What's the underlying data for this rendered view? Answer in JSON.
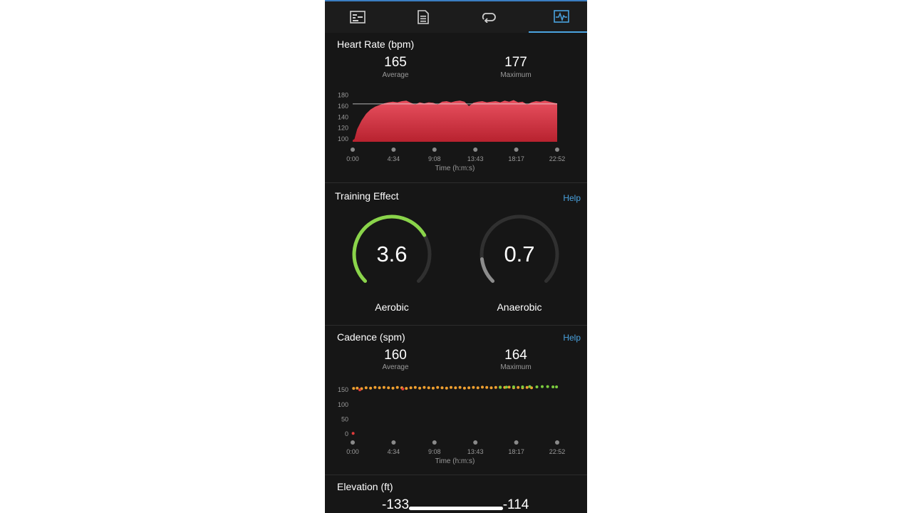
{
  "tabs": [
    {
      "icon": "summary-chart-icon"
    },
    {
      "icon": "document-list-icon"
    },
    {
      "icon": "laps-loop-icon"
    },
    {
      "icon": "activity-graph-icon",
      "active": true
    }
  ],
  "heart_rate": {
    "title": "Heart Rate (bpm)",
    "average_value": "165",
    "average_label": "Average",
    "maximum_value": "177",
    "maximum_label": "Maximum",
    "chart_data": {
      "type": "area",
      "title": "Heart Rate (bpm)",
      "xlabel": "Time (h:m:s)",
      "ylabel": "",
      "x_ticks": [
        "0:00",
        "4:34",
        "9:08",
        "13:43",
        "18:17",
        "22:52"
      ],
      "y_ticks": [
        "180",
        "160",
        "140",
        "120",
        "100"
      ],
      "ylim": [
        95,
        182
      ],
      "reference_line": 164,
      "color": "#d6374a",
      "series": [
        {
          "x_min": [
            0,
            0.2,
            0.5,
            1.0,
            1.5,
            2.0,
            2.5,
            3.0,
            3.5,
            4.0,
            4.5,
            5.0,
            5.5,
            6.0,
            6.5,
            7.0,
            7.5,
            8.0,
            8.5,
            9.0,
            9.5,
            10.0,
            10.5,
            11.0,
            11.5,
            12.0,
            12.5,
            13.0,
            13.5,
            14.0,
            14.5,
            15.0,
            15.5,
            16.0,
            16.5,
            17.0,
            17.5,
            18.0,
            18.5,
            19.0,
            19.5,
            20.0,
            20.5,
            21.0,
            21.5,
            22.0,
            22.5,
            22.87
          ],
          "values": [
            98,
            100,
            118,
            134,
            146,
            154,
            159,
            162,
            165,
            167,
            168,
            167,
            169,
            170,
            166,
            163,
            167,
            165,
            167,
            166,
            163,
            168,
            169,
            167,
            169,
            170,
            168,
            160,
            166,
            168,
            169,
            167,
            168,
            169,
            167,
            170,
            168,
            171,
            167,
            168,
            163,
            167,
            169,
            168,
            170,
            168,
            166,
            165
          ]
        }
      ]
    }
  },
  "training_effect": {
    "title": "Training Effect",
    "help": "Help",
    "aerobic_value": "3.6",
    "aerobic_label": "Aerobic",
    "aerobic_fraction": 0.72,
    "aerobic_color": "#8ad44a",
    "anaerobic_value": "0.7",
    "anaerobic_label": "Anaerobic",
    "anaerobic_fraction": 0.14,
    "anaerobic_color": "#8c8c8c"
  },
  "cadence": {
    "title": "Cadence (spm)",
    "help": "Help",
    "average_value": "160",
    "average_label": "Average",
    "maximum_value": "164",
    "maximum_label": "Maximum",
    "chart_data": {
      "type": "scatter",
      "title": "Cadence (spm)",
      "xlabel": "Time (h:m:s)",
      "ylabel": "",
      "x_ticks": [
        "0:00",
        "4:34",
        "9:08",
        "13:43",
        "18:17",
        "22:52"
      ],
      "y_ticks": [
        "150",
        "100",
        "50",
        "0"
      ],
      "ylim": [
        0,
        160
      ],
      "series": [
        {
          "name": "",
          "color": "#f0a030",
          "x_min": [
            0.1,
            0.5,
            1.0,
            1.5,
            2.0,
            2.5,
            3.0,
            3.5,
            4.0,
            4.5,
            5.0,
            5.5,
            6.0,
            6.5,
            7.0,
            7.5,
            8.0,
            8.5,
            9.0,
            9.5,
            10.0,
            10.5,
            11.0,
            11.5,
            12.0,
            12.5,
            13.0,
            13.5,
            14.0,
            14.5,
            15.0,
            15.5,
            16.0,
            16.5,
            17.0,
            17.5,
            18.0,
            18.5,
            19.0,
            19.5,
            20.0
          ],
          "values": [
            155,
            156,
            154,
            157,
            156,
            158,
            157,
            158,
            157,
            156,
            158,
            157,
            155,
            157,
            158,
            156,
            158,
            157,
            156,
            158,
            157,
            156,
            158,
            157,
            158,
            156,
            157,
            158,
            157,
            159,
            158,
            157,
            158,
            159,
            158,
            159,
            157,
            158,
            157,
            158,
            157
          ]
        },
        {
          "name": "",
          "color": "#7ccc3e",
          "x_min": [
            16.5,
            17.2,
            18.0,
            19.0,
            19.8,
            20.6,
            21.2,
            21.8,
            22.4,
            22.8
          ],
          "values": [
            158,
            159,
            160,
            160,
            161,
            160,
            161,
            161,
            160,
            160
          ]
        },
        {
          "name": "",
          "color": "#e03b3b",
          "x_min": [
            0.05,
            0.8,
            5.6
          ],
          "values": [
            2,
            150,
            153
          ]
        }
      ]
    }
  },
  "elevation": {
    "title": "Elevation (ft)",
    "average_value": "-133",
    "maximum_value": "-114"
  }
}
